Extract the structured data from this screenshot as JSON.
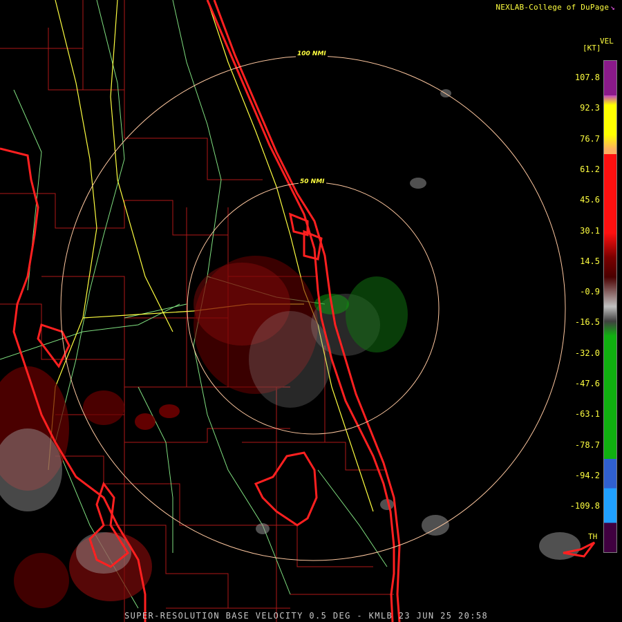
{
  "header": {
    "credit": "NEXLAB-College of DuPage",
    "credit_icon": "corner-arrow-icon"
  },
  "legend": {
    "title": "VEL",
    "unit": "[KT]",
    "ticks": [
      "107.8",
      "92.3",
      "76.7",
      "61.2",
      "45.6",
      "30.1",
      "14.5",
      "-0.9",
      "-16.5",
      "-32.0",
      "-47.6",
      "-63.1",
      "-78.7",
      "-94.2",
      "-109.8"
    ],
    "range_folded_label": "TH",
    "colors": {
      "purple": "#8a1a8a",
      "yellow": "#ffff00",
      "orange": "#ffb060",
      "red": "#ff1010",
      "dark_red": "#7a0000",
      "gray": "#c0c0c0",
      "green": "#10b010",
      "blue": "#3060d0",
      "cyan": "#20a0ff",
      "range_folded": "#400040"
    }
  },
  "range_rings": {
    "inner_label": "50 NMI",
    "outer_label": "100 NMI",
    "color": "#ffc8a0"
  },
  "map_colors": {
    "coast": "#ff2020",
    "county": "#b01818",
    "highway": "#ffff40",
    "road": "#80e080"
  },
  "footer": {
    "product": "SUPER-RESOLUTION BASE VELOCITY 0.5 DEG - KMLB 23 JUN 25 20:58"
  }
}
